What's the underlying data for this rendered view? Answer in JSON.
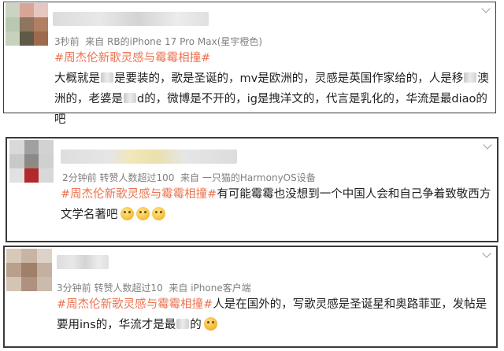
{
  "posts": [
    {
      "time": "3秒前",
      "source": "来自 RB的iPhone 17 Pro Max(星宇橙色)",
      "topic": "#周杰伦新歌灵感与霉霉相撞#",
      "text_a": "大概就是",
      "text_b": "是要装的，歌是圣诞的，mv是欧洲的，灵感是英国作家给的，人是移",
      "text_c": "澳洲的，老婆是",
      "text_d": "d的，微博是不开的，ig是拽洋文的，代言是乳化的，华流是最diao的吧"
    },
    {
      "time": "2分钟前",
      "reposts": "转赞人数超过100",
      "source": "来自 一只猫的HarmonyOS设备",
      "topic": "#周杰伦新歌灵感与霉霉相撞#",
      "text": "有可能霉霉也没想到一个中国人会和自己争着致敬西方文学名著吧"
    },
    {
      "time": "3分钟前",
      "reposts": "转赞人数超过10",
      "source": "来自 iPhone客户端",
      "topic": "#周杰伦新歌灵感与霉霉相撞#",
      "text_a": "人是在国外的，写歌灵感是圣诞星和奥路菲亚，发帖是要用ins的，华流才是最",
      "text_b": "的"
    }
  ],
  "icons": {
    "more": "chevron-down-icon",
    "emoji_think": "thinking-face-icon",
    "emoji_kiss": "kiss-face-icon"
  },
  "colors": {
    "topic": "#eb7350",
    "meta": "#808080",
    "border": "#3a3a3a"
  }
}
